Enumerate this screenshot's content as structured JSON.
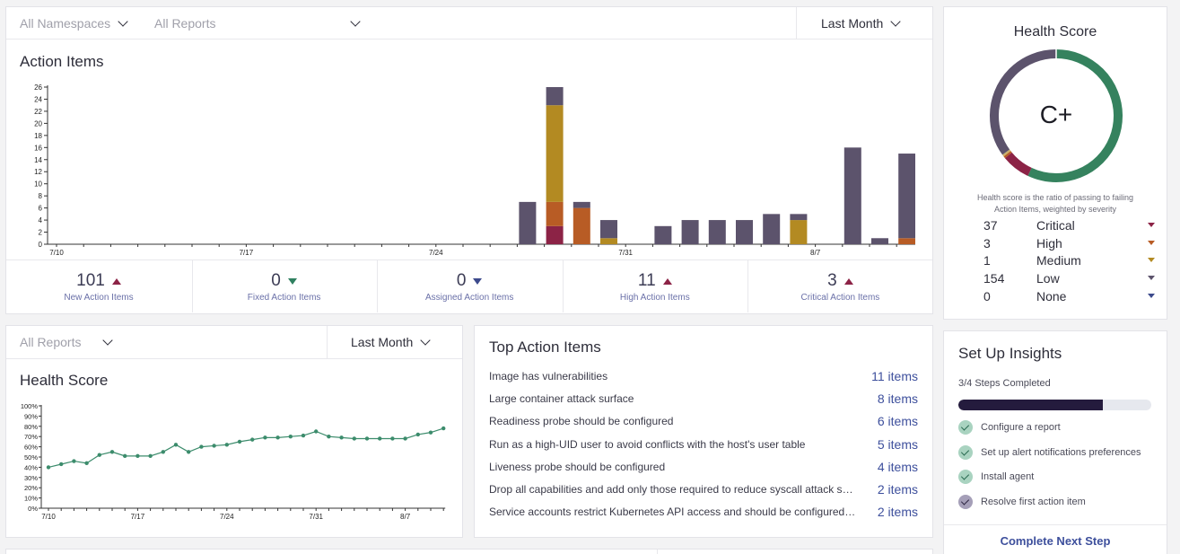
{
  "filters_top": {
    "namespaces": "All Namespaces",
    "reports": "All Reports",
    "period": "Last Month"
  },
  "action_items": {
    "title": "Action Items",
    "chart_data": {
      "type": "bar",
      "stacked": true,
      "y_ticks": [
        "0",
        "2",
        "4",
        "6",
        "8",
        "10",
        "12",
        "14",
        "16",
        "18",
        "20",
        "22",
        "24",
        "26"
      ],
      "ylim": [
        0,
        26
      ],
      "x_tick_labels": [
        {
          "i": 0,
          "label": "7/10"
        },
        {
          "i": 7,
          "label": "7/17"
        },
        {
          "i": 14,
          "label": "7/24"
        },
        {
          "i": 21,
          "label": "7/31"
        },
        {
          "i": 28,
          "label": "8/7"
        }
      ],
      "num_days": 32,
      "colors": {
        "critical": "#8c2346",
        "high": "#b85c25",
        "medium": "#b38a22",
        "low": "#5c536c"
      },
      "bars": [
        {
          "i": 17,
          "critical": 0,
          "high": 0,
          "medium": 0,
          "low": 7
        },
        {
          "i": 18,
          "critical": 3,
          "high": 4,
          "medium": 16,
          "low": 3
        },
        {
          "i": 19,
          "critical": 0,
          "high": 6,
          "medium": 0,
          "low": 1
        },
        {
          "i": 20,
          "critical": 0,
          "high": 0,
          "medium": 1,
          "low": 3
        },
        {
          "i": 22,
          "critical": 0,
          "high": 0,
          "medium": 0,
          "low": 3
        },
        {
          "i": 23,
          "critical": 0,
          "high": 0,
          "medium": 0,
          "low": 4
        },
        {
          "i": 24,
          "critical": 0,
          "high": 0,
          "medium": 0,
          "low": 4
        },
        {
          "i": 25,
          "critical": 0,
          "high": 0,
          "medium": 0,
          "low": 4
        },
        {
          "i": 26,
          "critical": 0,
          "high": 0,
          "medium": 0,
          "low": 5
        },
        {
          "i": 27,
          "critical": 0,
          "high": 0,
          "medium": 4,
          "low": 1
        },
        {
          "i": 29,
          "critical": 0,
          "high": 0,
          "medium": 0,
          "low": 16
        },
        {
          "i": 30,
          "critical": 0,
          "high": 0,
          "medium": 0,
          "low": 1
        },
        {
          "i": 31,
          "critical": 0,
          "high": 1,
          "medium": 0,
          "low": 14
        }
      ]
    },
    "stats": [
      {
        "value": "101",
        "label": "New Action Items",
        "trend": "up"
      },
      {
        "value": "0",
        "label": "Fixed Action Items",
        "trend": "down-green"
      },
      {
        "value": "0",
        "label": "Assigned Action Items",
        "trend": "down-blue"
      },
      {
        "value": "11",
        "label": "High Action Items",
        "trend": "up"
      },
      {
        "value": "3",
        "label": "Critical Action Items",
        "trend": "up"
      }
    ]
  },
  "health_score_card": {
    "title": "Health Score",
    "grade": "C+",
    "note_line1": "Health score is the ratio of passing to failing",
    "note_line2": "Action Items, weighted by severity",
    "donut": {
      "passing_fraction": 0.57,
      "critical": 0.07,
      "high": 0.005,
      "medium": 0.005,
      "low": 0.35,
      "colors": {
        "passing": "#35825e",
        "critical": "#8c2346",
        "high": "#b85c25",
        "medium": "#c9b06a",
        "low": "#5c536c"
      }
    },
    "severities": [
      {
        "count": "37",
        "name": "Critical",
        "color": "#8c2346"
      },
      {
        "count": "3",
        "name": "High",
        "color": "#b85c25"
      },
      {
        "count": "1",
        "name": "Medium",
        "color": "#b38a22"
      },
      {
        "count": "154",
        "name": "Low",
        "color": "#5c536c"
      },
      {
        "count": "0",
        "name": "None",
        "color": "#3c4a8c"
      }
    ]
  },
  "filters_bottom": {
    "reports": "All Reports",
    "period": "Last Month"
  },
  "health_history": {
    "title": "Health Score",
    "chart_data": {
      "type": "line",
      "y_ticks": [
        "0%",
        "10%",
        "20%",
        "30%",
        "40%",
        "50%",
        "60%",
        "70%",
        "80%",
        "90%",
        "100%"
      ],
      "ylim": [
        0,
        100
      ],
      "x_tick_labels": [
        {
          "i": 0,
          "label": "7/10"
        },
        {
          "i": 7,
          "label": "7/17"
        },
        {
          "i": 14,
          "label": "7/24"
        },
        {
          "i": 21,
          "label": "7/31"
        },
        {
          "i": 28,
          "label": "8/7"
        }
      ],
      "values": [
        40,
        43,
        46,
        44,
        52,
        55,
        51,
        51,
        51,
        55,
        62,
        55,
        60,
        61,
        62,
        65,
        67,
        69,
        69,
        70,
        71,
        75,
        70,
        69,
        68,
        68,
        68,
        68,
        68,
        72,
        74,
        78
      ],
      "color": "#3c8c6c"
    }
  },
  "top_action_items": {
    "title": "Top Action Items",
    "rows": [
      {
        "text": "Image has vulnerabilities",
        "count": "11 items"
      },
      {
        "text": "Large container attack surface",
        "count": "8 items"
      },
      {
        "text": "Readiness probe should be configured",
        "count": "6 items"
      },
      {
        "text": "Run as a high-UID user to avoid conflicts with the host's user table",
        "count": "5 items"
      },
      {
        "text": "Liveness probe should be configured",
        "count": "4 items"
      },
      {
        "text": "Drop all capabilities and add only those required to reduce syscall attack surface",
        "count": "2 items"
      },
      {
        "text": "Service accounts restrict Kubernetes API access and should be configured with least privilege",
        "count": "2 items"
      }
    ]
  },
  "insights": {
    "title": "Set Up Insights",
    "progress_label": "3/4 Steps Completed",
    "progress": 0.75,
    "steps": [
      {
        "label": "Configure a report",
        "done": true
      },
      {
        "label": "Set up alert notifications preferences",
        "done": true
      },
      {
        "label": "Install agent",
        "done": true
      },
      {
        "label": "Resolve first action item",
        "done": false
      }
    ],
    "cta": "Complete Next Step"
  }
}
